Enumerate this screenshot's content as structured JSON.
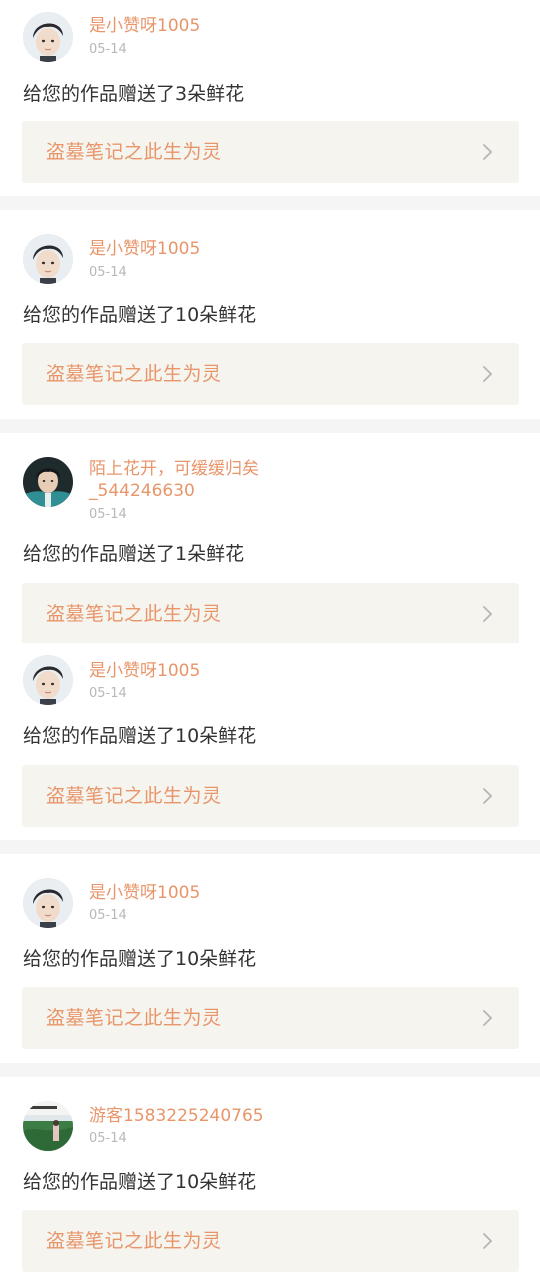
{
  "colors": {
    "accent": "#e8956a",
    "date": "#b8b8b8",
    "message": "#333333",
    "book_bg": "#f5f4ee",
    "separator": "#f5f5f5"
  },
  "items": [
    {
      "user": "是小赞呀1005",
      "date": "05-14",
      "message": "给您的作品赠送了3朵鲜花",
      "book": "盗墓笔记之此生为灵",
      "avatar_icon": "boy-portrait-avatar"
    },
    {
      "user": "是小赞呀1005",
      "date": "05-14",
      "message": "给您的作品赠送了10朵鲜花",
      "book": "盗墓笔记之此生为灵",
      "avatar_icon": "boy-portrait-avatar"
    },
    {
      "user": "陌上花开，可缓缓归矣\n_544246630",
      "date": "05-14",
      "message": "给您的作品赠送了1朵鲜花",
      "book": "盗墓笔记之此生为灵",
      "avatar_icon": "boy-teal-jacket-avatar"
    },
    {
      "user": "是小赞呀1005",
      "date": "05-14",
      "message": "给您的作品赠送了10朵鲜花",
      "book": "盗墓笔记之此生为灵",
      "avatar_icon": "boy-portrait-avatar"
    },
    {
      "user": "是小赞呀1005",
      "date": "05-14",
      "message": "给您的作品赠送了10朵鲜花",
      "book": "盗墓笔记之此生为灵",
      "avatar_icon": "boy-portrait-avatar"
    },
    {
      "user": "游客1583225240765",
      "date": "05-14",
      "message": "给您的作品赠送了10朵鲜花",
      "book": "盗墓笔记之此生为灵",
      "avatar_icon": "landscape-photo-avatar"
    }
  ]
}
